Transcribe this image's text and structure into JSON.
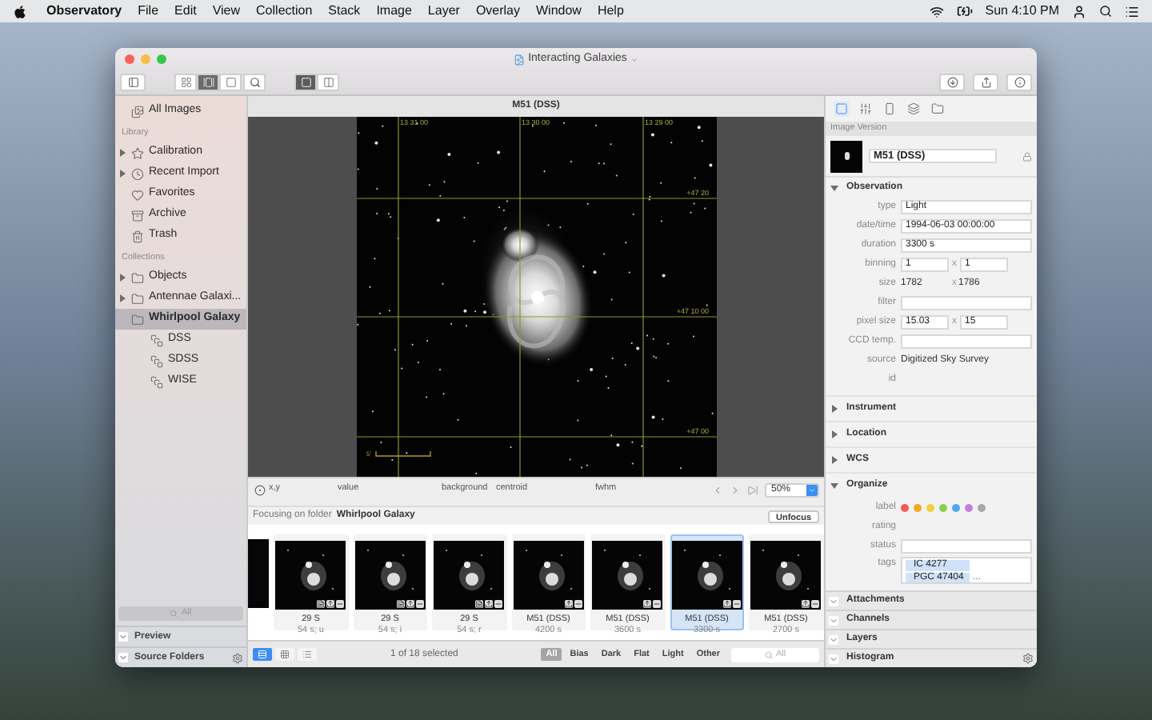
{
  "menubar": {
    "app_name": "Observatory",
    "menus": [
      "File",
      "Edit",
      "View",
      "Collection",
      "Stack",
      "Image",
      "Layer",
      "Overlay",
      "Window",
      "Help"
    ],
    "clock": "Sun 4:10 PM"
  },
  "window": {
    "title": "Interacting Galaxies",
    "browser_modes": [
      {
        "kind": "grid",
        "selected": false
      },
      {
        "kind": "filmstrip",
        "selected": true
      },
      {
        "kind": "single",
        "selected": false
      }
    ],
    "layout_modes": [
      {
        "kind": "single",
        "selected": true
      },
      {
        "kind": "split",
        "selected": false
      }
    ]
  },
  "sidebar": {
    "top_item": {
      "label": "All Images",
      "selected": false
    },
    "sections": [
      {
        "title": "Library",
        "items": [
          {
            "label": "Calibration",
            "kind": "star",
            "expandable": true,
            "selected": false
          },
          {
            "label": "Recent Import",
            "kind": "clock",
            "expandable": true,
            "selected": false
          },
          {
            "label": "Favorites",
            "kind": "heart",
            "expandable": false,
            "selected": false
          },
          {
            "label": "Archive",
            "kind": "archive",
            "expandable": false,
            "selected": false
          },
          {
            "label": "Trash",
            "kind": "trash",
            "expandable": false,
            "selected": false
          }
        ]
      },
      {
        "title": "Collections",
        "items": [
          {
            "label": "Objects",
            "kind": "folder",
            "expandable": true,
            "selected": false
          },
          {
            "label": "Antennae Galaxi...",
            "kind": "folder",
            "expandable": true,
            "selected": false
          },
          {
            "label": "Whirlpool Galaxy",
            "kind": "folder",
            "expandable": false,
            "selected": true,
            "children": [
              {
                "label": "DSS",
                "kind": "stack",
                "selected": false
              },
              {
                "label": "SDSS",
                "kind": "stack",
                "selected": false
              },
              {
                "label": "WISE",
                "kind": "stack",
                "selected": false
              }
            ]
          }
        ]
      }
    ],
    "search": {
      "placeholder": "All"
    },
    "panels": [
      {
        "label": "Preview"
      },
      {
        "label": "Source Folders"
      }
    ]
  },
  "viewer": {
    "title": "M51 (DSS)",
    "ra_labels": [
      "13 31 00",
      "13 30 00",
      "13 29 00"
    ],
    "dec_labels": [
      "+47 20",
      "+47 10 00",
      "+47 00"
    ],
    "scale_label": "5'",
    "readout_columns": [
      "x,y",
      "value",
      "background",
      "centroid",
      "fwhm"
    ],
    "zoom": "50%"
  },
  "focus": {
    "prefix": "Focusing on folder",
    "folder": "Whirlpool Galaxy",
    "button": "Unfocus"
  },
  "filmstrip": [
    {
      "title": "29 S",
      "subtitle": "54 s; u",
      "selected": false,
      "badges": [
        {
          "kind": "document"
        },
        {
          "kind": "export"
        },
        {
          "kind": "remove"
        }
      ]
    },
    {
      "title": "29 S",
      "subtitle": "54 s; i",
      "selected": false,
      "badges": [
        {
          "kind": "document"
        },
        {
          "kind": "export"
        },
        {
          "kind": "remove"
        }
      ]
    },
    {
      "title": "29 S",
      "subtitle": "54 s; r",
      "selected": false,
      "badges": [
        {
          "kind": "document"
        },
        {
          "kind": "export"
        },
        {
          "kind": "remove"
        }
      ]
    },
    {
      "title": "M51 (DSS)",
      "subtitle": "4200 s",
      "selected": false,
      "badges": [
        {
          "kind": "export"
        },
        {
          "kind": "remove"
        }
      ]
    },
    {
      "title": "M51 (DSS)",
      "subtitle": "3600 s",
      "selected": false,
      "badges": [
        {
          "kind": "export"
        },
        {
          "kind": "remove"
        }
      ]
    },
    {
      "title": "M51 (DSS)",
      "subtitle": "3300 s",
      "selected": true,
      "badges": [
        {
          "kind": "export"
        },
        {
          "kind": "remove"
        }
      ]
    },
    {
      "title": "M51 (DSS)",
      "subtitle": "2700 s",
      "selected": false,
      "badges": [
        {
          "kind": "export"
        },
        {
          "kind": "remove"
        }
      ]
    }
  ],
  "bottom_bar": {
    "view_modes": [
      {
        "kind": "list",
        "selected": true
      },
      {
        "kind": "grid",
        "selected": false
      },
      {
        "kind": "table",
        "selected": false
      }
    ],
    "status": "1 of 18 selected",
    "filters": [
      {
        "label": "All",
        "selected": true
      },
      {
        "label": "Bias",
        "selected": false
      },
      {
        "label": "Dark",
        "selected": false
      },
      {
        "label": "Flat",
        "selected": false
      },
      {
        "label": "Light",
        "selected": false
      },
      {
        "label": "Other",
        "selected": false
      }
    ],
    "search": {
      "placeholder": "All"
    }
  },
  "inspector": {
    "tabs": [
      {
        "kind": "image",
        "selected": true
      },
      {
        "kind": "adjust",
        "selected": false
      },
      {
        "kind": "panel",
        "selected": false
      },
      {
        "kind": "layers",
        "selected": false
      },
      {
        "kind": "folder",
        "selected": false
      }
    ],
    "heading": "Image Version",
    "version_name": "M51 (DSS)",
    "observation": {
      "title": "Observation",
      "expanded": true,
      "fields": [
        {
          "label": "type",
          "kind": "field",
          "value": "Light"
        },
        {
          "label": "date/time",
          "kind": "field",
          "value": "1994-06-03 00:00:00"
        },
        {
          "label": "duration",
          "kind": "field",
          "value": "3300 s"
        },
        {
          "label": "binning",
          "kind": "pair",
          "value": "1",
          "separator": "x",
          "value2": "1"
        },
        {
          "label": "size",
          "kind": "pair_text",
          "value": "1782",
          "separator": "x",
          "value2": "1786"
        },
        {
          "label": "filter",
          "kind": "field"
        },
        {
          "label": "pixel size",
          "kind": "pair",
          "value": "15.03",
          "separator": "x",
          "value2": "15"
        },
        {
          "label": "CCD temp.",
          "kind": "field"
        },
        {
          "label": "source",
          "kind": "text",
          "value": "Digitized Sky Survey"
        },
        {
          "label": "id",
          "kind": "text"
        }
      ]
    },
    "sections": [
      {
        "title": "Instrument",
        "expanded": false
      },
      {
        "title": "Location",
        "expanded": false
      },
      {
        "title": "WCS",
        "expanded": false
      }
    ],
    "organize": {
      "title": "Organize",
      "expanded": true,
      "label_label": "label",
      "labels": [
        {
          "color": "#f25a54"
        },
        {
          "color": "#f5a623"
        },
        {
          "color": "#eed23c"
        },
        {
          "color": "#8ccf4e"
        },
        {
          "color": "#4aa7f2"
        },
        {
          "color": "#c17fe0"
        },
        {
          "color": "#a8a8a8"
        }
      ],
      "rating_label": "rating",
      "status_label": "status",
      "tags_label": "tags",
      "tags": [
        "IC 4277",
        "PGC 47404"
      ],
      "more": "..."
    },
    "panels": [
      {
        "label": "Attachments",
        "settings": false
      },
      {
        "label": "Channels",
        "settings": false
      },
      {
        "label": "Layers",
        "settings": false
      },
      {
        "label": "Histogram",
        "settings": true
      }
    ]
  }
}
